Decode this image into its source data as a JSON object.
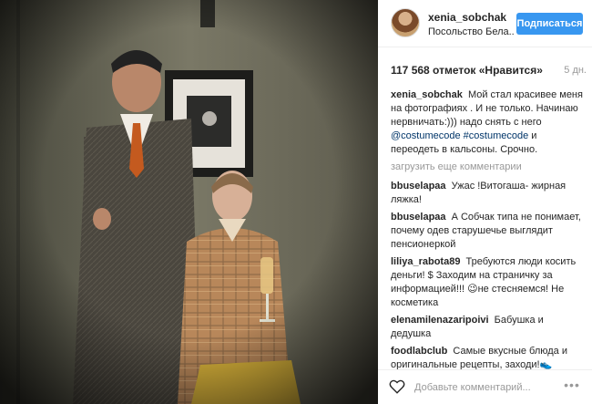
{
  "post": {
    "header": {
      "username": "xenia_sobchak",
      "location": "Посольство Бела..",
      "follow_label": "Подписаться",
      "avatar_icon": "user-avatar"
    },
    "likes_text": "117 568 отметок «Нравится»",
    "timestamp": "5 дн.",
    "caption": {
      "user": "xenia_sobchak",
      "text_1": "Мой стал красивее меня на фотографиях . И не только. Начинаю нервничать:))) надо снять с него",
      "tag_1": "@costumecode",
      "tag_2": "#costumecode",
      "text_2": "и переодеть в кальсоны. Срочно."
    },
    "load_more_label": "загрузить еще комментарии",
    "comments": [
      {
        "user": "bbuselapaa",
        "text": "Ужас !Витогаша- жирная ляжка!"
      },
      {
        "user": "bbuselapaa",
        "text": "А Собчак типа не понимает, почему одев старушечье выглядит пенсионеркой"
      },
      {
        "user": "liliya_rabota89",
        "text": "Требуются люди косить деньги! $  Заходим на страничку за информацией!!! 😉не стесняемся! Не косметика"
      },
      {
        "user": "elenamilenazaripoivi",
        "text": "Бабушка и дедушка"
      },
      {
        "user": "foodlabclub",
        "text": "Самые вкусные блюда и оригинальные рецепты, заходи!👟"
      }
    ],
    "footer": {
      "comment_placeholder": "Добавьте комментарий...",
      "like_icon": "heart-icon",
      "more_icon": "more-options-icon"
    },
    "colors": {
      "accent": "#3897f0",
      "hashtag": "#003569",
      "muted": "#999999"
    }
  }
}
